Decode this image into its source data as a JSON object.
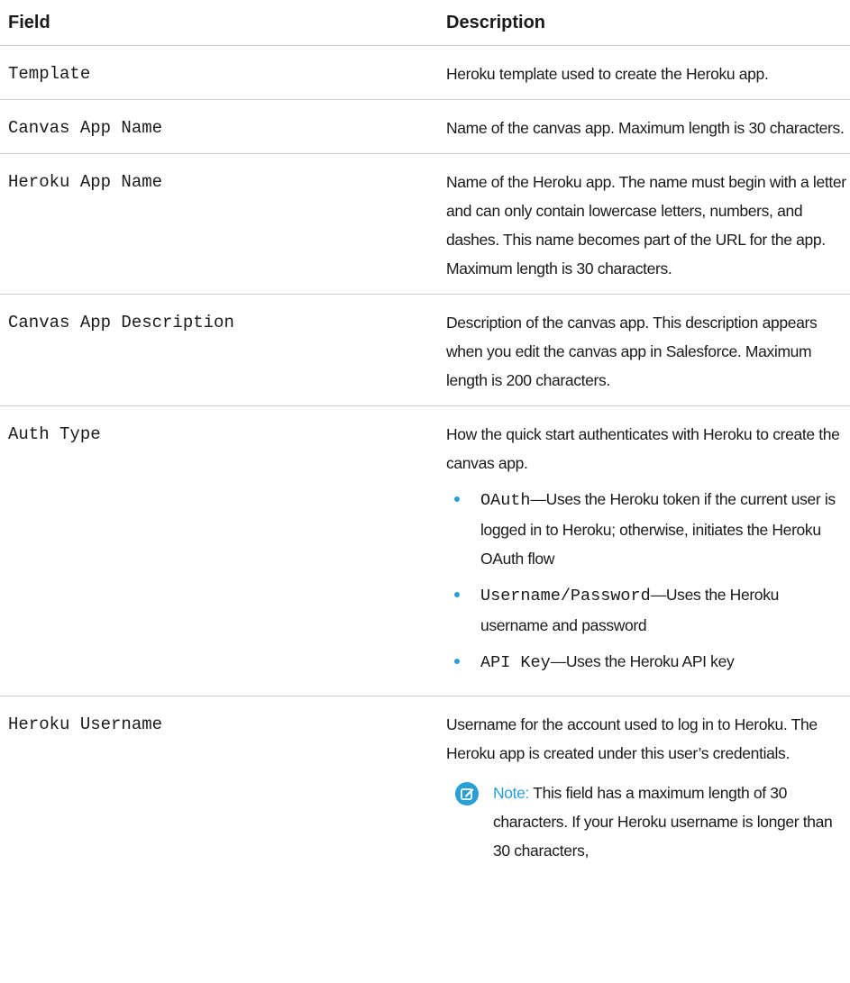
{
  "header": {
    "field": "Field",
    "description": "Description"
  },
  "rows": [
    {
      "field": "Template",
      "description": "Heroku template used to create the Heroku app."
    },
    {
      "field": "Canvas App Name",
      "description": "Name of the canvas app. Maximum length is 30 characters."
    },
    {
      "field": "Heroku App Name",
      "description": "Name of the Heroku app. The name must begin with a letter and can only contain lowercase letters, numbers, and dashes. This name becomes part of the URL for the app. Maximum length is 30 characters."
    },
    {
      "field": "Canvas App Description",
      "description": "Description of the canvas app. This description appears when you edit the canvas app in Salesforce. Maximum length is 200 characters."
    },
    {
      "field": "Auth Type",
      "description": "How the quick start authenticates with Heroku to create the canvas app.",
      "bullets": [
        {
          "code": "OAuth",
          "text": "—Uses the Heroku token if the current user is logged in to Heroku; otherwise, initiates the Heroku OAuth flow"
        },
        {
          "code": "Username/Password",
          "text": "—Uses the Heroku username and password"
        },
        {
          "code": "API Key",
          "text": "—Uses the Heroku API key"
        }
      ]
    },
    {
      "field": "Heroku Username",
      "description": "Username for the account used to log in to Heroku. The Heroku app is created under this user’s credentials.",
      "note": {
        "label": "Note:",
        "text": "This field has a maximum length of 30 characters. If your Heroku username is longer than 30 characters,"
      }
    }
  ],
  "colors": {
    "accent": "#2a9fd6",
    "divider": "#c9c9c9"
  },
  "icons": {
    "bullet": "bullet-dot",
    "note": "note-edit-icon"
  }
}
